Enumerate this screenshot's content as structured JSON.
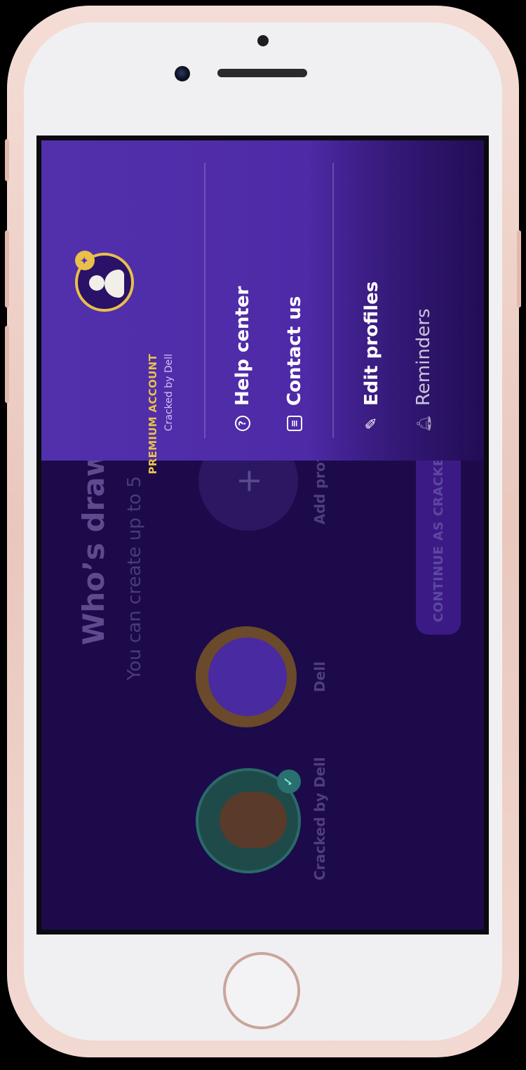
{
  "menu": {
    "account_title": "PREMIUM ACCOUNT",
    "account_sub": "Cracked by Dell",
    "items": [
      {
        "label": "Help center",
        "icon": "question-circle-icon"
      },
      {
        "label": "Contact us",
        "icon": "chat-icon"
      },
      {
        "label": "Edit profiles",
        "icon": "pencil-icon"
      },
      {
        "label": "Reminders",
        "icon": "bell-icon"
      }
    ]
  },
  "profiles": {
    "heading": "Who’s drawir",
    "subheading": "You can create up to 5",
    "list": [
      {
        "name": "Cracked by Dell"
      },
      {
        "name": "Dell"
      },
      {
        "name": "Add profile"
      }
    ],
    "continue_label": "CONTINUE AS CRACKED BY"
  },
  "colors": {
    "menu_bg": "#5230ac",
    "app_bg": "#1d0a4a",
    "premium_gold": "#e8c04a"
  }
}
